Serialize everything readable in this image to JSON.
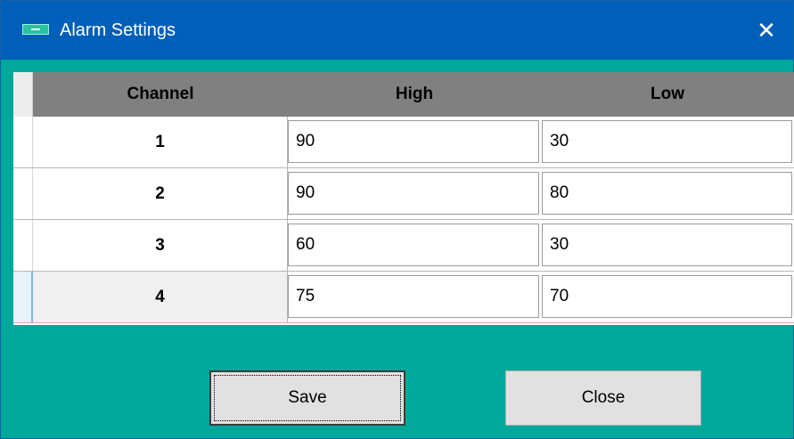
{
  "window": {
    "title": "Alarm Settings",
    "close_glyph": "✕",
    "icon": "app-icon"
  },
  "grid": {
    "columns": [
      "Channel",
      "High",
      "Low"
    ],
    "rows": [
      {
        "channel": "1",
        "high": "90",
        "low": "30"
      },
      {
        "channel": "2",
        "high": "90",
        "low": "80"
      },
      {
        "channel": "3",
        "high": "60",
        "low": "30"
      },
      {
        "channel": "4",
        "high": "75",
        "low": "70"
      }
    ],
    "current_row": 4
  },
  "buttons": {
    "save_label": "Save",
    "close_label": "Close"
  },
  "colors": {
    "titlebar": "#005fb8",
    "background": "#00a89b",
    "header": "#808080"
  }
}
